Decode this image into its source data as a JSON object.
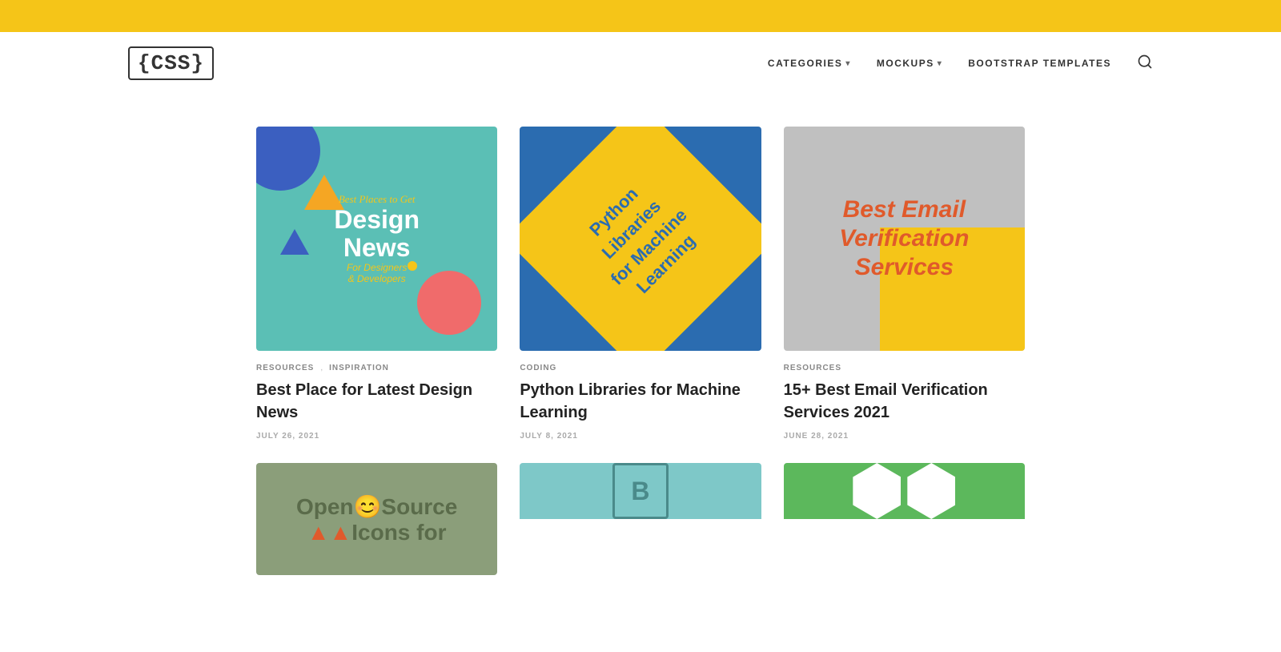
{
  "topbar": {
    "color": "#F5C518"
  },
  "header": {
    "logo": "{CSS}",
    "nav": [
      {
        "label": "CATEGORIES",
        "hasDropdown": true
      },
      {
        "label": "MOCKUPS",
        "hasDropdown": true
      },
      {
        "label": "BOOTSTRAP TEMPLATES",
        "hasDropdown": false
      }
    ],
    "searchAriaLabel": "Search"
  },
  "cards": [
    {
      "id": "card-1",
      "tags": [
        "RESOURCES",
        "INSPIRATION"
      ],
      "tagSeparator": ",",
      "title": "Best Place for Latest Design News",
      "date": "JULY 26, 2021",
      "imageLines": [
        "Best Places to",
        "Get",
        "Design",
        "News",
        "For Designers",
        "& Developers"
      ]
    },
    {
      "id": "card-2",
      "tags": [
        "CODING"
      ],
      "title": "Python Libraries for Machine Learning",
      "date": "JULY 8, 2021",
      "imageLines": [
        "Python",
        "Libraries",
        "for Machine",
        "Learning"
      ]
    },
    {
      "id": "card-3",
      "tags": [
        "RESOURCES"
      ],
      "title": "15+ Best Email Verification Services 2021",
      "date": "JUNE 28, 2021",
      "imageLines": [
        "Best Email",
        "Verification",
        "Services"
      ]
    }
  ],
  "bottomCards": [
    {
      "id": "card-4",
      "imageType": "open-source"
    },
    {
      "id": "card-5",
      "imageType": "bootstrap"
    },
    {
      "id": "card-6",
      "imageType": "hexagon"
    }
  ]
}
